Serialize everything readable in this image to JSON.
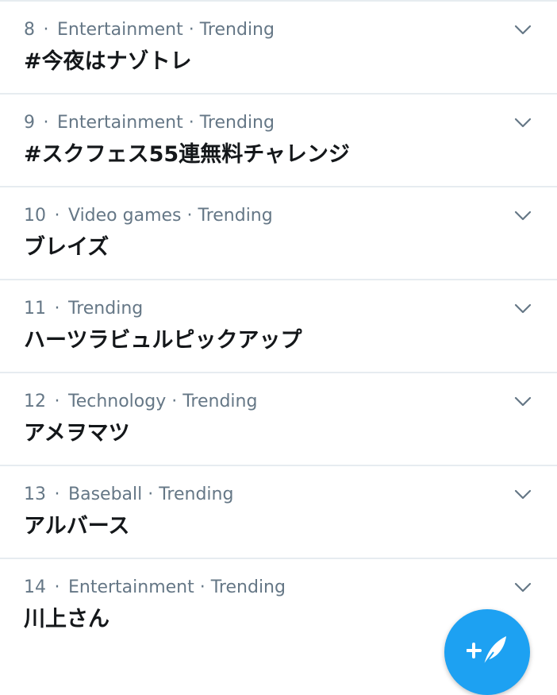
{
  "colors": {
    "meta_text": "#657786",
    "title_text": "#14171a",
    "divider": "#e6ecf0",
    "accent": "#1da1f2"
  },
  "separator": "·",
  "trends": [
    {
      "rank": "8",
      "category": "Entertainment · Trending",
      "title": "#今夜はナゾトレ"
    },
    {
      "rank": "9",
      "category": "Entertainment · Trending",
      "title": "#スクフェス55連無料チャレンジ"
    },
    {
      "rank": "10",
      "category": "Video games · Trending",
      "title": "ブレイズ"
    },
    {
      "rank": "11",
      "category": "Trending",
      "title": "ハーツラビュルピックアップ"
    },
    {
      "rank": "12",
      "category": "Technology · Trending",
      "title": "アメヲマツ"
    },
    {
      "rank": "13",
      "category": "Baseball · Trending",
      "title": "アルバース"
    },
    {
      "rank": "14",
      "category": "Entertainment · Trending",
      "title": "川上さん"
    }
  ],
  "icons": {
    "row_menu": "chevron-down-icon",
    "compose": "compose-tweet-icon"
  }
}
